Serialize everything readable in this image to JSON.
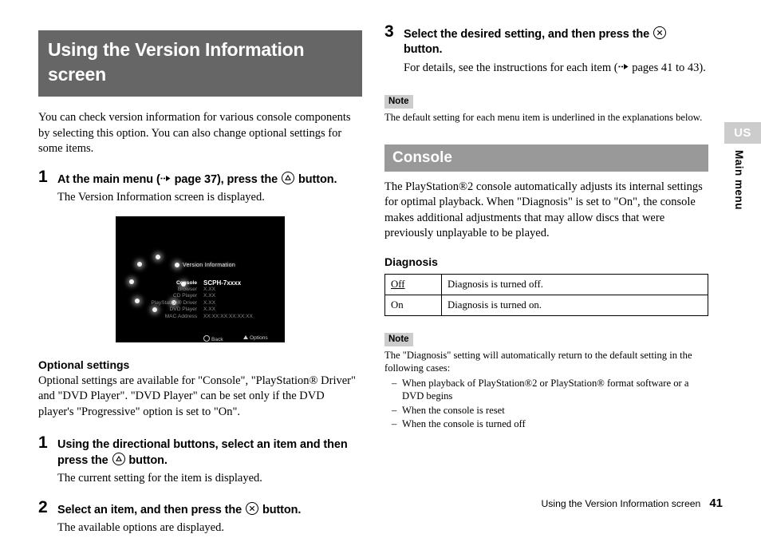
{
  "chapter": {
    "title": "Using the Version Information screen"
  },
  "left": {
    "intro": "You can check version information for various console components by selecting this option. You can also change optional settings for some items.",
    "steps": [
      {
        "num": "1",
        "head_pre": "At the main menu (",
        "head_mid": " page 37), press the ",
        "head_post": " button.",
        "glyph": "triangle-button",
        "sub": "The Version Information screen is displayed."
      },
      {
        "num": "1",
        "head_pre": "Using the directional buttons, select an item and then press the ",
        "head_mid": "",
        "head_post": " button.",
        "glyph": "triangle-button",
        "sub": "The current setting for the item is displayed."
      },
      {
        "num": "2",
        "head_pre": "Select an item, and then press the ",
        "head_mid": "",
        "head_post": " button.",
        "glyph": "cross-button",
        "sub": "The available options are displayed."
      }
    ],
    "screenshot": {
      "title": "Version Information",
      "rows": [
        {
          "label": "Console",
          "value": "SCPH-7xxxx",
          "highlight": true
        },
        {
          "label": "Browser",
          "value": "X.XX",
          "highlight": false
        },
        {
          "label": "CD Player",
          "value": "X.XX",
          "highlight": false
        },
        {
          "label": "PlayStation® Driver",
          "value": "X.XX",
          "highlight": false
        },
        {
          "label": "DVD Player",
          "value": "X.XX",
          "highlight": false
        },
        {
          "label": "MAC Address",
          "value": "XX:XX:XX:XX:XX:XX",
          "highlight": false
        }
      ],
      "footer_back": "Back",
      "footer_options": "Options"
    },
    "optional_heading": "Optional settings",
    "optional_body": "Optional settings are available for \"Console\", \"PlayStation® Driver\" and \"DVD Player\". \"DVD Player\" can be set only if the DVD player's \"Progressive\" option is set to \"On\"."
  },
  "right": {
    "step3": {
      "num": "3",
      "head_pre": "Select the desired setting, and then press the ",
      "head_post": " button.",
      "glyph": "cross-button",
      "sub_pre": "For details, see the instructions for each item (",
      "sub_post": " pages 41 to 43)."
    },
    "note1": {
      "badge": "Note",
      "body": "The default setting for each menu item is underlined in the explanations below."
    },
    "section_title": "Console",
    "section_body": "The PlayStation®2 console automatically adjusts its internal settings for optimal playback. When \"Diagnosis\" is set to \"On\", the console makes additional adjustments that may allow discs that were previously unplayable to be played.",
    "diagnosis_heading": "Diagnosis",
    "diagnosis_table": {
      "rows": [
        {
          "key": "Off",
          "underlined": true,
          "desc": "Diagnosis is turned off."
        },
        {
          "key": "On",
          "underlined": false,
          "desc": "Diagnosis is turned on."
        }
      ]
    },
    "note2": {
      "badge": "Note",
      "body": "The \"Diagnosis\" setting will automatically return to the default setting in the following cases:",
      "items": [
        "When playback of PlayStation®2 or PlayStation® format software or a DVD begins",
        "When the console is reset",
        "When the console is turned off"
      ]
    }
  },
  "tabs": {
    "region": "US",
    "side": "Main menu"
  },
  "footer": {
    "title": "Using the Version Information screen",
    "page": "41"
  },
  "colors": {
    "chapter_bar": "#666666",
    "section_bar": "#999999",
    "note_badge": "#cccccc",
    "region_badge": "#cccccc"
  }
}
